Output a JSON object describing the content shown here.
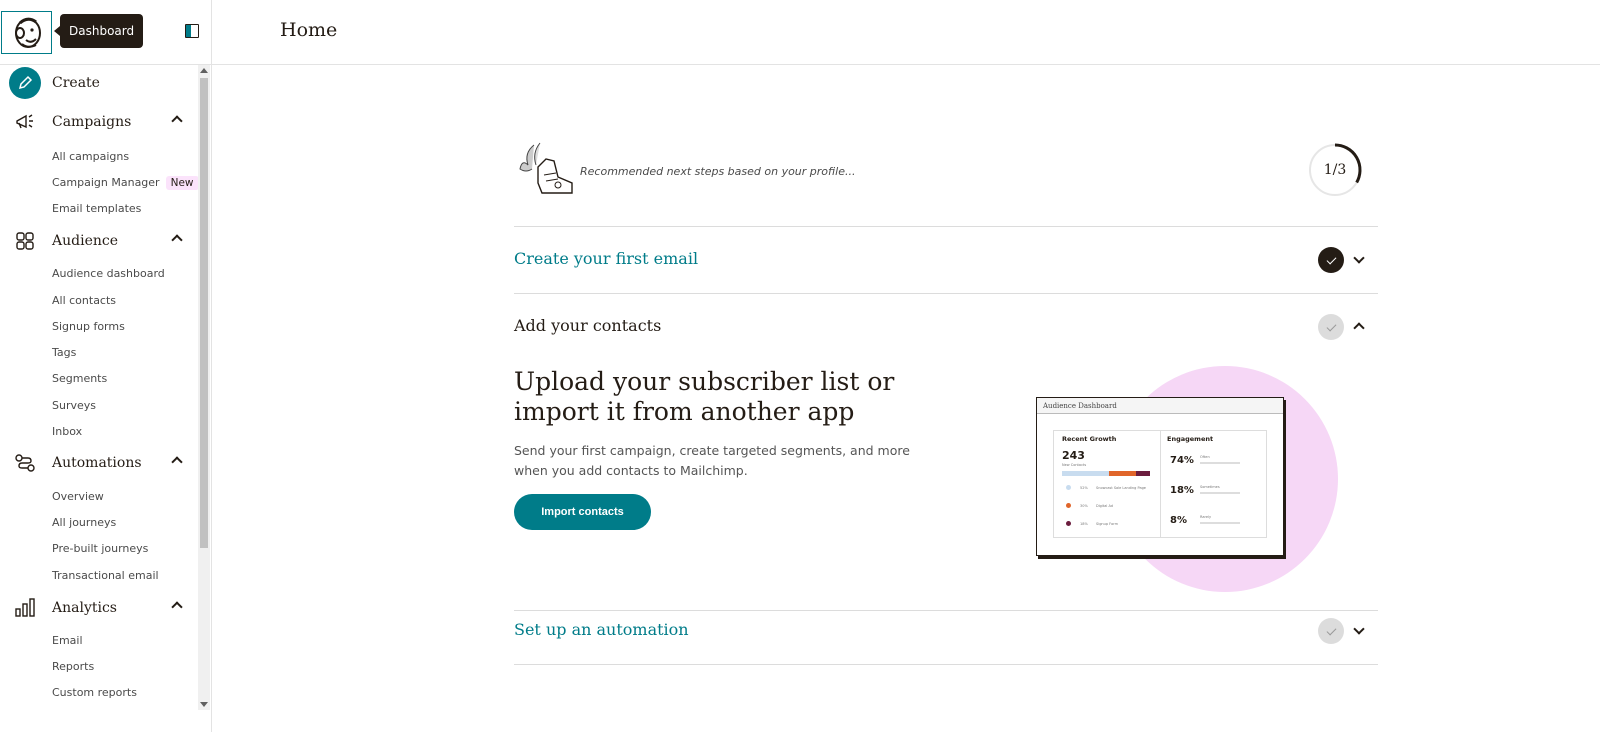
{
  "tooltip": {
    "label": "Dashboard"
  },
  "sidebar": {
    "create_label": "Create",
    "sections": [
      {
        "label": "Campaigns",
        "items": [
          "All campaigns",
          "Campaign Manager",
          "Email templates"
        ],
        "badge": "New"
      },
      {
        "label": "Audience",
        "items": [
          "Audience dashboard",
          "All contacts",
          "Signup forms",
          "Tags",
          "Segments",
          "Surveys",
          "Inbox"
        ]
      },
      {
        "label": "Automations",
        "items": [
          "Overview",
          "All journeys",
          "Pre-built journeys",
          "Transactional email"
        ]
      },
      {
        "label": "Analytics",
        "items": [
          "Email",
          "Reports",
          "Custom reports"
        ]
      }
    ]
  },
  "header": {
    "title": "Home"
  },
  "recommend": {
    "text": "Recommended next steps based on your profile...",
    "progress": "1/3",
    "progress_fraction": 0.333
  },
  "steps": [
    {
      "title": "Create your first email",
      "status": "done",
      "expanded": false
    },
    {
      "title": "Add your contacts",
      "status": "todo",
      "expanded": true
    },
    {
      "title": "Set up an automation",
      "status": "todo",
      "expanded": false
    }
  ],
  "contacts_panel": {
    "heading": "Upload your subscriber list or import it from another app",
    "description": "Send your first campaign, create targeted segments, and more when you add contacts to Mailchimp.",
    "button": "Import contacts"
  },
  "illustration": {
    "card_title": "Audience Dashboard",
    "growth_label": "Recent Growth",
    "growth_value": "243",
    "growth_sub": "New Contacts",
    "sources": [
      {
        "pct": "52%",
        "label": "Snowcast Sale Landing Page",
        "color": "#c8dcef"
      },
      {
        "pct": "30%",
        "label": "Digital Ad",
        "color": "#e0652a"
      },
      {
        "pct": "18%",
        "label": "Signup Form",
        "color": "#6b1d3e"
      }
    ],
    "engagement_label": "Engagement",
    "engagement": [
      {
        "pct": "74%",
        "label": "Often"
      },
      {
        "pct": "18%",
        "label": "Sometimes"
      },
      {
        "pct": "8%",
        "label": "Rarely"
      }
    ]
  }
}
